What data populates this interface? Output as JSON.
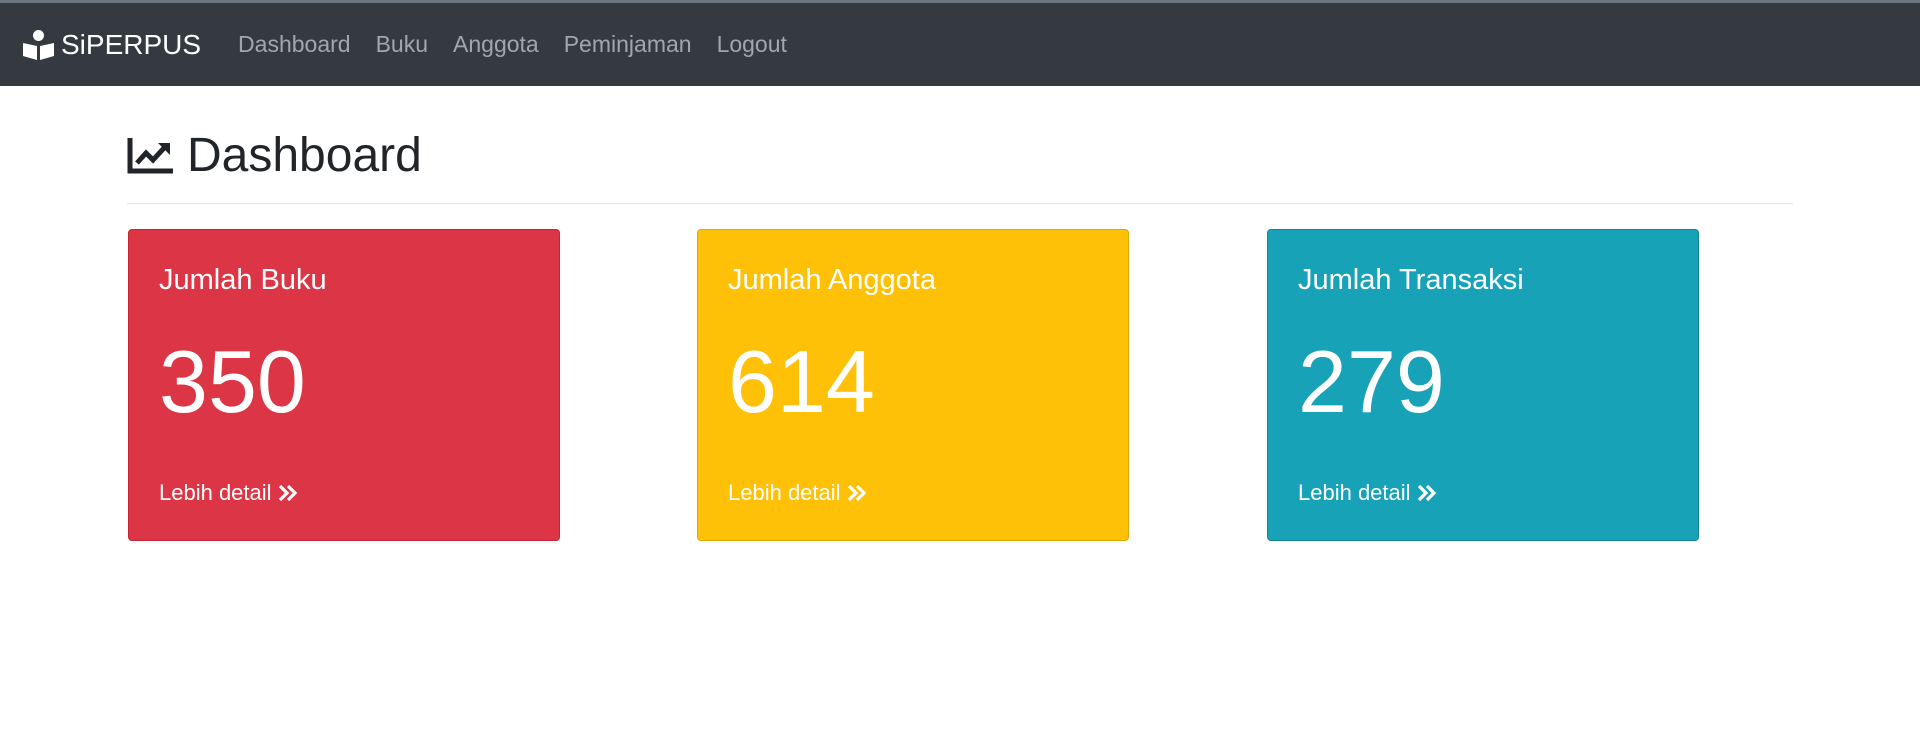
{
  "navbar": {
    "brand": "SiPERPUS",
    "brand_icon": "book-reader-icon",
    "items": [
      {
        "label": "Dashboard"
      },
      {
        "label": "Buku"
      },
      {
        "label": "Anggota"
      },
      {
        "label": "Peminjaman"
      },
      {
        "label": "Logout"
      }
    ]
  },
  "page": {
    "title": "Dashboard",
    "title_icon": "chart-line-icon"
  },
  "cards": [
    {
      "title": "Jumlah Buku",
      "value": "350",
      "link": "Lebih detail",
      "color": "#dc3545"
    },
    {
      "title": "Jumlah Anggota",
      "value": "614",
      "link": "Lebih detail",
      "color": "#ffc107"
    },
    {
      "title": "Jumlah Transaksi",
      "value": "279",
      "link": "Lebih detail",
      "color": "#17a2b8"
    }
  ],
  "colors": {
    "navbar_bg": "#343a40",
    "nav_link": "#9a9da0"
  }
}
